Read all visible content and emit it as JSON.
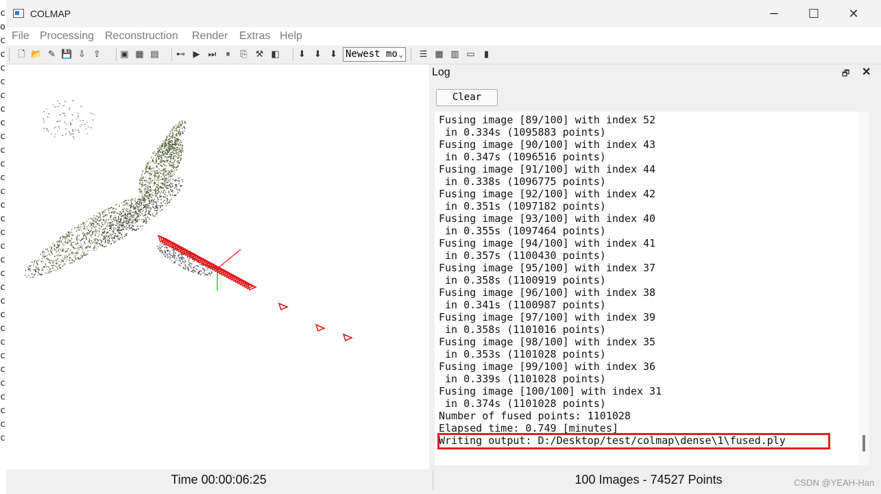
{
  "window": {
    "title": "COLMAP"
  },
  "titlebar_buttons": {
    "minimize": "─",
    "maximize": "☐",
    "close": "✕"
  },
  "menu": [
    "File",
    "Processing",
    "Reconstruction",
    "Render",
    "Extras",
    "Help"
  ],
  "toolbar": {
    "group1": [
      {
        "name": "new-project-icon",
        "glyph": "🗋"
      },
      {
        "name": "open-project-icon",
        "glyph": "📂"
      },
      {
        "name": "edit-project-icon",
        "glyph": "✎"
      },
      {
        "name": "save-project-icon",
        "glyph": "💾"
      },
      {
        "name": "import-model-icon",
        "glyph": "⇩"
      },
      {
        "name": "export-model-icon",
        "glyph": "⇧"
      }
    ],
    "group2": [
      {
        "name": "feature-extraction-icon",
        "glyph": "▣"
      },
      {
        "name": "feature-matching-icon",
        "glyph": "▦"
      },
      {
        "name": "database-icon",
        "glyph": "▤"
      }
    ],
    "group3": [
      {
        "name": "reconstruction-options-icon",
        "glyph": "⊷"
      },
      {
        "name": "start-icon",
        "glyph": "▶"
      },
      {
        "name": "step-icon",
        "glyph": "⏭"
      },
      {
        "name": "pause-icon",
        "glyph": "⏸"
      },
      {
        "name": "reset-icon",
        "glyph": "⎘"
      },
      {
        "name": "bundle-adjustment-icon",
        "glyph": "⚒"
      },
      {
        "name": "dense-reconstruction-icon",
        "glyph": "◧"
      }
    ],
    "group4": [
      {
        "name": "render-options-icon",
        "glyph": "⬇"
      },
      {
        "name": "reset-view-icon",
        "glyph": "⬇"
      },
      {
        "name": "grab-image-icon",
        "glyph": "⬇"
      }
    ],
    "combo_value": "Newest mo",
    "group5": [
      {
        "name": "reconstruction-stats-icon",
        "glyph": "☰"
      },
      {
        "name": "match-matrix-icon",
        "glyph": "▦"
      },
      {
        "name": "log-chart-icon",
        "glyph": "▥"
      },
      {
        "name": "show-log-icon",
        "glyph": "▭"
      },
      {
        "name": "project-info-icon",
        "glyph": "▮"
      }
    ]
  },
  "log": {
    "title": "Log",
    "float_glyph": "🗗",
    "close_glyph": "✕",
    "clear_label": "Clear",
    "lines": [
      "Fusing image [89/100] with index 52",
      " in 0.334s (1095883 points)",
      "Fusing image [90/100] with index 43",
      " in 0.347s (1096516 points)",
      "Fusing image [91/100] with index 44",
      " in 0.338s (1096775 points)",
      "Fusing image [92/100] with index 42",
      " in 0.351s (1097182 points)",
      "Fusing image [93/100] with index 40",
      " in 0.355s (1097464 points)",
      "Fusing image [94/100] with index 41",
      " in 0.357s (1100430 points)",
      "Fusing image [95/100] with index 37",
      " in 0.358s (1100919 points)",
      "Fusing image [96/100] with index 38",
      " in 0.341s (1100987 points)",
      "Fusing image [97/100] with index 39",
      " in 0.358s (1101016 points)",
      "Fusing image [98/100] with index 35",
      " in 0.353s (1101028 points)",
      "Fusing image [99/100] with index 36",
      " in 0.339s (1101028 points)",
      "Fusing image [100/100] with index 31",
      " in 0.374s (1101028 points)",
      "Number of fused points: 1101028",
      "Elapsed time: 0.749 [minutes]",
      "Writing output: D:/Desktop/test/colmap\\dense\\1\\fused.ply"
    ]
  },
  "status": {
    "time": "Time 00:00:06:25",
    "counts": "100 Images - 74527 Points"
  },
  "watermark": "CSDN @YEAH-Han",
  "colors": {
    "highlight": "#e02020",
    "camera": "#e01010"
  }
}
